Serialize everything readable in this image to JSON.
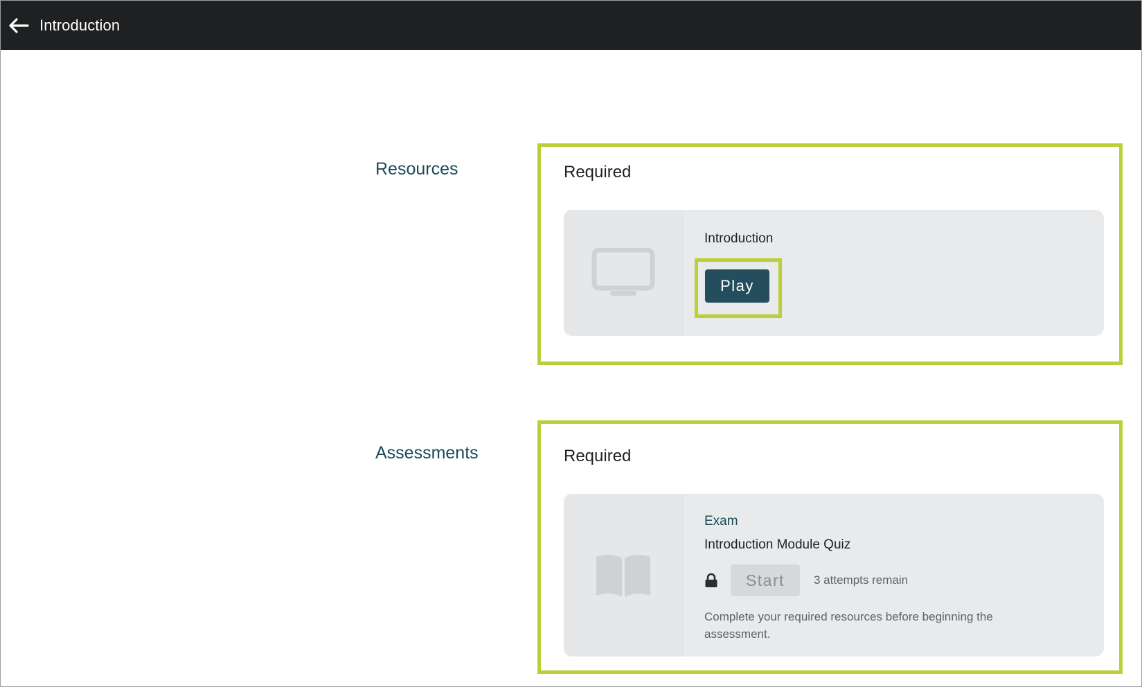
{
  "header": {
    "title": "Introduction",
    "back_icon": "arrow-left-icon"
  },
  "sections": {
    "resources": {
      "label": "Resources",
      "group_heading": "Required",
      "item": {
        "icon": "monitor-icon",
        "title": "Introduction",
        "action_label": "Play"
      }
    },
    "assessments": {
      "label": "Assessments",
      "group_heading": "Required",
      "item": {
        "icon": "open-book-icon",
        "type": "Exam",
        "title": "Introduction Module Quiz",
        "lock_icon": "lock-icon",
        "action_label": "Start",
        "attempts_text": "3 attempts remain",
        "note": "Complete your required resources before beginning the assessment."
      }
    }
  },
  "colors": {
    "header_bg": "#1f2021",
    "highlight": "#bccf3a",
    "primary_button": "#244e5e",
    "section_label": "#1c4a5a",
    "card_bg": "#e9eaec"
  }
}
